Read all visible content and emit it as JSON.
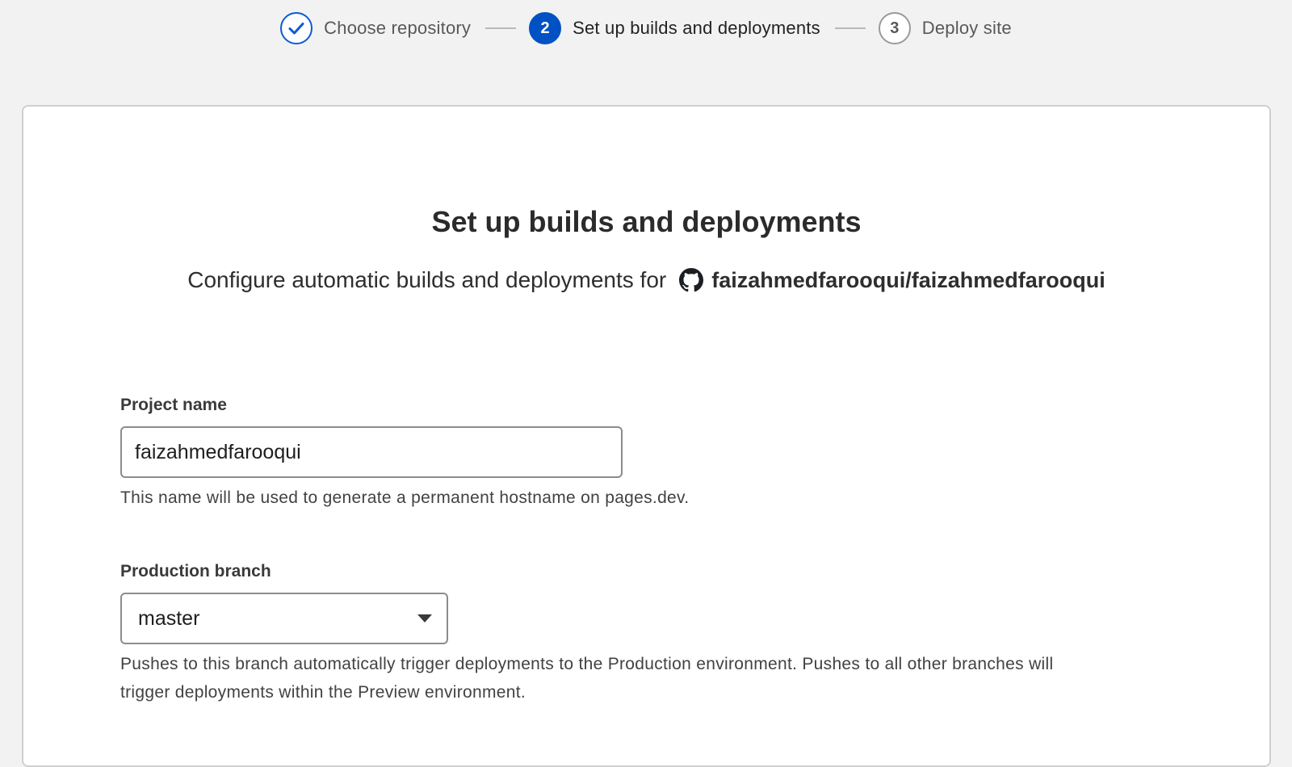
{
  "stepper": {
    "steps": [
      {
        "number": "",
        "label": "Choose repository",
        "state": "done"
      },
      {
        "number": "2",
        "label": "Set up builds and deployments",
        "state": "active"
      },
      {
        "number": "3",
        "label": "Deploy site",
        "state": "pending"
      }
    ]
  },
  "card": {
    "title": "Set up builds and deployments",
    "subtitle": "Configure automatic builds and deployments for",
    "repo_icon": "github-icon",
    "repo": "faizahmedfarooqui/faizahmedfarooqui"
  },
  "project_name": {
    "label": "Project name",
    "value": "faizahmedfarooqui",
    "help": "This name will be used to generate a permanent hostname on pages.dev."
  },
  "production_branch": {
    "label": "Production branch",
    "selected": "master",
    "help": "Pushes to this branch automatically trigger deployments to the Production environment. Pushes to all other branches will trigger deployments within the Preview environment."
  },
  "colors": {
    "accent": "#0051c3",
    "background": "#f2f2f2",
    "card": "#ffffff"
  }
}
